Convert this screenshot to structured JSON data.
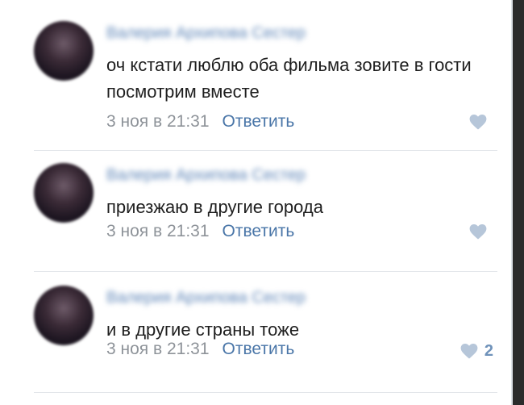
{
  "comments": [
    {
      "author": "Валерия Архипова Сестер",
      "text": "оч кстати люблю оба фильма зовите в гости посмотрим вместе",
      "date": "3 ноя в 21:31",
      "reply_label": "Ответить",
      "like_icon": "heart-icon",
      "like_count": ""
    },
    {
      "author": "Валерия Архипова Сестер",
      "text": "приезжаю в другие города",
      "date": "3 ноя в 21:31",
      "reply_label": "Ответить",
      "like_icon": "heart-icon",
      "like_count": ""
    },
    {
      "author": "Валерия Архипова Сестер",
      "text": "и в другие страны тоже",
      "date": "3 ноя в 21:31",
      "reply_label": "Ответить",
      "like_icon": "heart-icon",
      "like_count": "2"
    }
  ],
  "colors": {
    "link": "#4a76a8",
    "date": "#8e9399",
    "like_icon": "#b6c6d9"
  }
}
